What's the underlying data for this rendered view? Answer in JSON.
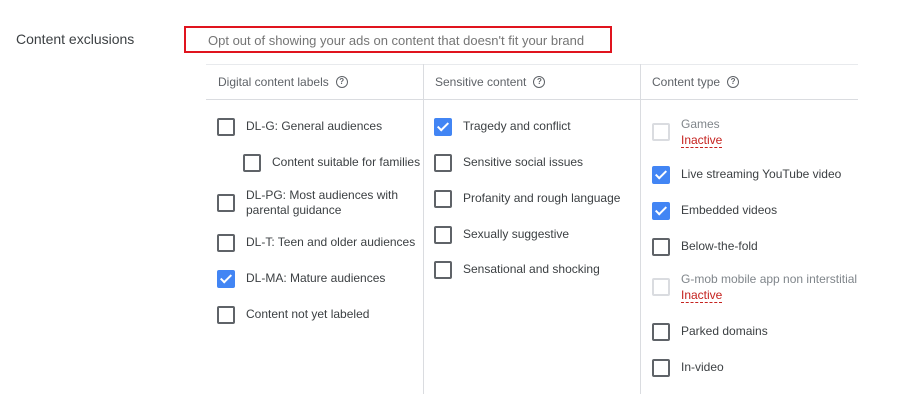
{
  "section": {
    "label": "Content exclusions",
    "description": "Opt out of showing your ads on content that doesn't fit your brand"
  },
  "columns": [
    {
      "header": "Digital content labels",
      "options": [
        {
          "label": "DL-G: General audiences",
          "checked": false
        },
        {
          "label": "Content suitable for families",
          "checked": false
        },
        {
          "label": "DL-PG: Most audiences with parental guidance",
          "checked": false
        },
        {
          "label": "DL-T: Teen and older audiences",
          "checked": false
        },
        {
          "label": "DL-MA: Mature audiences",
          "checked": true
        },
        {
          "label": "Content not yet labeled",
          "checked": false
        }
      ]
    },
    {
      "header": "Sensitive content",
      "options": [
        {
          "label": "Tragedy and conflict",
          "checked": true
        },
        {
          "label": "Sensitive social issues",
          "checked": false
        },
        {
          "label": "Profanity and rough language",
          "checked": false
        },
        {
          "label": "Sexually suggestive",
          "checked": false
        },
        {
          "label": "Sensational and shocking",
          "checked": false
        }
      ]
    },
    {
      "header": "Content type",
      "options": [
        {
          "label": "Games",
          "checked": false,
          "disabled": true,
          "status": "Inactive"
        },
        {
          "label": "Live streaming YouTube video",
          "checked": true
        },
        {
          "label": "Embedded videos",
          "checked": true
        },
        {
          "label": "Below-the-fold",
          "checked": false
        },
        {
          "label": "G-mob mobile app non interstitial",
          "checked": false,
          "disabled": true,
          "status": "Inactive"
        },
        {
          "label": "Parked domains",
          "checked": false
        },
        {
          "label": "In-video",
          "checked": false
        }
      ]
    }
  ],
  "colors": {
    "accent": "#4285f4",
    "inactive": "#c5221f",
    "highlight_box": "#e0141e"
  }
}
